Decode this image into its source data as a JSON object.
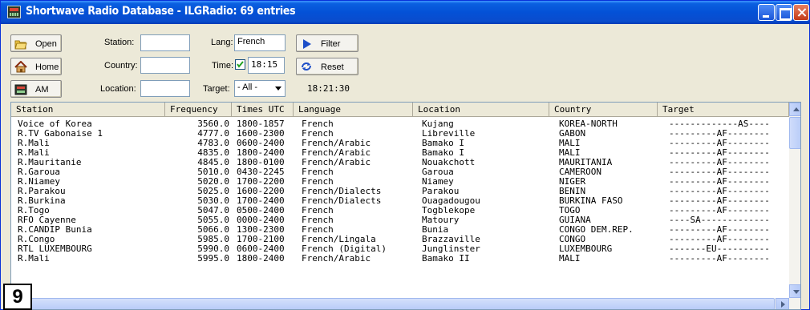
{
  "window": {
    "title": "Shortwave Radio Database - ILGRadio: 69 entries"
  },
  "toolbar": {
    "open_label": "Open",
    "home_label": "Home",
    "am_label": "AM",
    "station_label": "Station:",
    "station_value": "",
    "country_label": "Country:",
    "country_value": "",
    "location_label": "Location:",
    "location_value": "",
    "lang_label": "Lang:",
    "lang_value": "French",
    "time_label": "Time:",
    "time_checked": true,
    "time_value": "18:15",
    "target_label": "Target:",
    "target_value": "- All -",
    "filter_label": "Filter",
    "reset_label": "Reset",
    "clock": "18:21:30"
  },
  "table": {
    "columns": [
      "Station",
      "Frequency",
      "Times UTC",
      "Language",
      "Location",
      "Country",
      "Target"
    ],
    "rows": [
      [
        "Voice of Korea",
        "3560.0",
        "1800-1857",
        "French",
        "Kujang",
        "KOREA-NORTH",
        "-------------AS----"
      ],
      [
        "R.TV Gabonaise 1",
        "4777.0",
        "1600-2300",
        "French",
        "Libreville",
        "GABON",
        "---------AF--------"
      ],
      [
        "R.Mali",
        "4783.0",
        "0600-2400",
        "French/Arabic",
        "Bamako I",
        "MALI",
        "---------AF--------"
      ],
      [
        "R.Mali",
        "4835.0",
        "1800-2400",
        "French/Arabic",
        "Bamako I",
        "MALI",
        "---------AF--------"
      ],
      [
        "R.Mauritanie",
        "4845.0",
        "1800-0100",
        "French/Arabic",
        "Nouakchott",
        "MAURITANIA",
        "---------AF--------"
      ],
      [
        "R.Garoua",
        "5010.0",
        "0430-2245",
        "French",
        "Garoua",
        "CAMEROON",
        "---------AF--------"
      ],
      [
        "R.Niamey",
        "5020.0",
        "1700-2200",
        "French",
        "Niamey",
        "NIGER",
        "---------AF--------"
      ],
      [
        "R.Parakou",
        "5025.0",
        "1600-2200",
        "French/Dialects",
        "Parakou",
        "BENIN",
        "---------AF--------"
      ],
      [
        "R.Burkina",
        "5030.0",
        "1700-2400",
        "French/Dialects",
        "Ouagadougou",
        "BURKINA FASO",
        "---------AF--------"
      ],
      [
        "R.Togo",
        "5047.0",
        "0500-2400",
        "French",
        "Togblekope",
        "TOGO",
        "---------AF--------"
      ],
      [
        "RFO Cayenne",
        "5055.0",
        "0000-2400",
        "French",
        "Matoury",
        "GUIANA",
        "----SA-------------"
      ],
      [
        "R.CANDIP Bunia",
        "5066.0",
        "1300-2300",
        "French",
        "Bunia",
        "CONGO DEM.REP.",
        "---------AF--------"
      ],
      [
        "R.Congo",
        "5985.0",
        "1700-2100",
        "French/Lingala",
        "Brazzaville",
        "CONGO",
        "---------AF--------"
      ],
      [
        "RTL LUXEMBOURG",
        "5990.0",
        "0600-2400",
        "French  (Digital)",
        "Junglinster",
        "LUXEMBOURG",
        "-------EU----------"
      ],
      [
        "R.Mali",
        "5995.0",
        "1800-2400",
        "French/Arabic",
        "Bamako II",
        "MALI",
        "---------AF--------"
      ]
    ]
  },
  "figure_number": "9",
  "colors": {
    "titlebar": "#0451d6",
    "window_bg": "#ece9d8",
    "close_button": "#c33a18"
  }
}
